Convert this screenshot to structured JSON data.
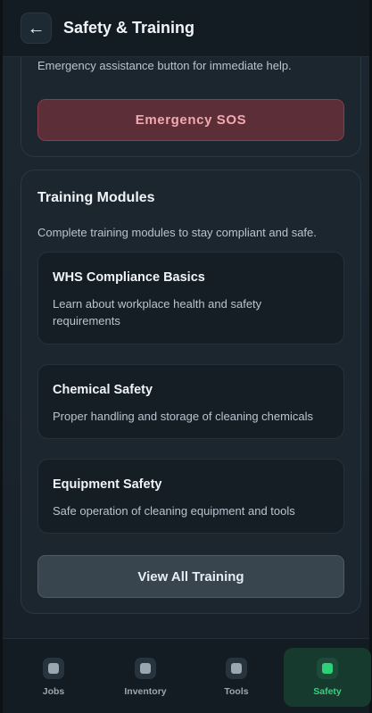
{
  "header": {
    "back_icon": "←",
    "title": "Safety & Training"
  },
  "emergency": {
    "description": "Emergency assistance button for immediate help.",
    "button_label": "Emergency SOS"
  },
  "training": {
    "title": "Training Modules",
    "description": "Complete training modules to stay compliant and safe.",
    "modules": [
      {
        "title": "WHS Compliance Basics",
        "description": "Learn about workplace health and safety requirements"
      },
      {
        "title": "Chemical Safety",
        "description": "Proper handling and storage of cleaning chemicals"
      },
      {
        "title": "Equipment Safety",
        "description": "Safe operation of cleaning equipment and tools"
      }
    ],
    "view_all_label": "View All Training"
  },
  "nav": {
    "items": [
      {
        "label": "Jobs",
        "icon": "jobs-icon",
        "active": false
      },
      {
        "label": "Inventory",
        "icon": "inventory-icon",
        "active": false
      },
      {
        "label": "Tools",
        "icon": "tools-icon",
        "active": false
      },
      {
        "label": "Safety",
        "icon": "safety-icon",
        "active": true
      }
    ],
    "active_color": "#37d07f"
  },
  "colors": {
    "background": "#1a242c",
    "sos_button": "#5b2e38",
    "sos_text": "#f2a9b0"
  }
}
